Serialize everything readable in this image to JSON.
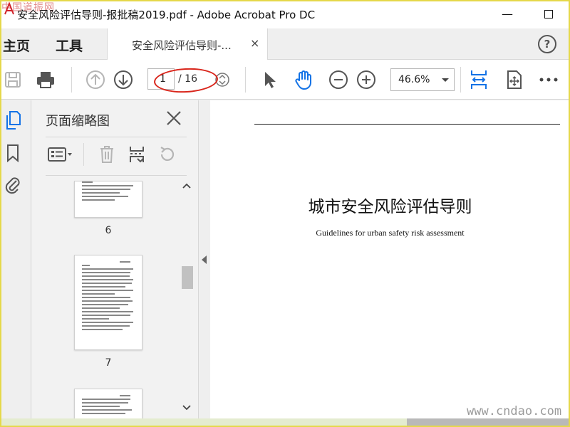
{
  "titlebar": {
    "title": "安全风险评估导则-报批稿2019.pdf - Adobe Acrobat Pro DC",
    "watermark": "中国道振网",
    "minimize": "—"
  },
  "tabs": {
    "home": "主页",
    "tools": "工具",
    "document": "安全风险评估导则-...",
    "close": "×",
    "help": "?"
  },
  "toolbar": {
    "current_page": "1",
    "total_pages": "/ 16",
    "zoom": "46.6%"
  },
  "panel": {
    "title": "页面缩略图",
    "thumbnails": [
      {
        "label": "6"
      },
      {
        "label": "7"
      },
      {
        "label": ""
      }
    ]
  },
  "document": {
    "title": "城市安全风险评估导则",
    "subtitle": "Guidelines for urban safety risk assessment"
  },
  "footer": {
    "watermark": "www.cndao.com"
  },
  "colors": {
    "accent_blue": "#1473e6",
    "annotation_red": "#d9261c",
    "icon_grey": "#555555",
    "disabled_grey": "#b5b5b5"
  }
}
